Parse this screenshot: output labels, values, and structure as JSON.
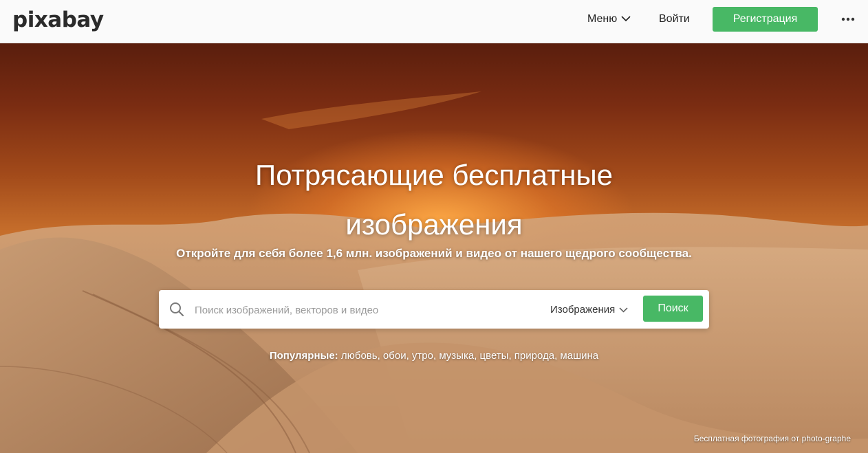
{
  "header": {
    "logo": "pixabay",
    "menu_label": "Меню",
    "login_label": "Войти",
    "register_label": "Регистрация"
  },
  "hero": {
    "title_line1": "Потрясающие бесплатные",
    "title_line2": "изображения",
    "subtitle": "Откройте для себя более 1,6 млн. изображений и видео от нашего щедрого сообщества."
  },
  "search": {
    "placeholder": "Поиск изображений, векторов и видео",
    "type_label": "Изображения",
    "button_label": "Поиск"
  },
  "popular": {
    "label": "Популярные:",
    "items": [
      "любовь",
      "обои",
      "утро",
      "музыка",
      "цветы",
      "природа",
      "машина"
    ]
  },
  "credit": "Бесплатная фотография от photo-graphe",
  "colors": {
    "accent": "#48b865",
    "header_bg": "#fafafa",
    "text_dark": "#1f1f1f"
  },
  "icons": {
    "menu_chevron": "chevron-down-icon",
    "more": "more-dots-icon",
    "search": "search-icon",
    "type_chevron": "chevron-down-icon"
  }
}
